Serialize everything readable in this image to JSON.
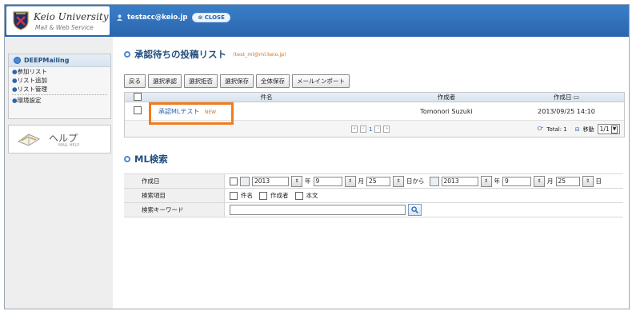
{
  "header": {
    "logo_title": "Keio University",
    "logo_subtitle": "Mail & Web Service",
    "user_email": "testacc@keio.jp",
    "close_label": "CLOSE"
  },
  "sidebar": {
    "menu_title": "DEEPMailing",
    "items": [
      {
        "label": "参加リスト"
      },
      {
        "label": "リスト追加"
      },
      {
        "label": "リスト管理"
      },
      {
        "label": "環境設定"
      }
    ],
    "help_label": "ヘルプ",
    "help_sub": "MAIL HELP"
  },
  "pending": {
    "title": "承認待ちの投稿リスト",
    "list_address": "(test_ml@ml.keio.jp)",
    "toolbar": [
      "戻る",
      "選択承認",
      "選択拒否",
      "選択保存",
      "全体保存",
      "メールインポート"
    ],
    "columns": {
      "subject": "件名",
      "author": "作成者",
      "date": "作成日"
    },
    "rows": [
      {
        "subject": "承認MLテスト",
        "badge": "NEW",
        "author": "Tomonori Suzuki",
        "date": "2013/09/25 14:10"
      }
    ],
    "pager": {
      "page": "1",
      "total_label": "Total: 1",
      "move_label": "移動",
      "page_select": "1/1"
    }
  },
  "search": {
    "title": "ML検索",
    "date_label": "作成日",
    "from": {
      "year": "2013",
      "month": "9",
      "day": "25"
    },
    "to": {
      "year": "2013",
      "month": "9",
      "day": "25"
    },
    "year_unit": "年",
    "month_unit": "月",
    "from_suffix": "日から",
    "to_suffix": "日",
    "field_label": "検索項目",
    "fields": [
      "件名",
      "作成者",
      "本文"
    ],
    "keyword_label": "検索キーワード",
    "keyword_value": ""
  },
  "colors": {
    "accent": "#2a65ad",
    "highlight": "#f07c1e",
    "new_badge": "#d9711b"
  }
}
